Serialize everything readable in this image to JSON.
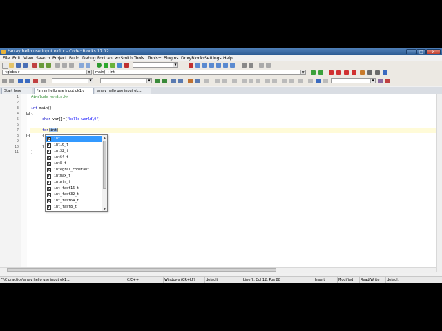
{
  "window": {
    "title": "*array hello use input ok1.c - Code::Blocks 17.12",
    "min": "_",
    "max": "□",
    "close": "x"
  },
  "menu": [
    "File",
    "Edit",
    "View",
    "Search",
    "Project",
    "Build",
    "Debug",
    "Fortran",
    "wxSmith",
    "Tools",
    "Tools+",
    "Plugins",
    "DoxyBlocks",
    "Settings",
    "Help"
  ],
  "toolbar": {
    "scope_select": "<global>",
    "function_select": "main() : int"
  },
  "tabs": [
    {
      "label": "Start here"
    },
    {
      "label": "*array hello use input ok1.c",
      "active": true
    },
    {
      "label": "array hello use input ok.c"
    }
  ],
  "editor": {
    "line_numbers": [
      "1",
      "2",
      "3",
      "4",
      "5",
      "6",
      "7",
      "8",
      "9",
      "10",
      "11"
    ],
    "line1": "#include <stdio.h>",
    "line3_kw": "int",
    "line3_rest": " main()",
    "line4": "{",
    "line5_kw": "char",
    "line5_mid": " var[]={",
    "line5_str": "\"hello world\\0\"",
    "line5_end": "}",
    "line7_kw": "for",
    "line7_paren": "(",
    "line7_typed": "int",
    "line7_close": ")",
    "line8": "{",
    "line10": "}",
    "line11": "}"
  },
  "autocomplete": {
    "icon": "C",
    "items": [
      "int",
      "int16_t",
      "int32_t",
      "int64_t",
      "int8_t",
      "integral_constant",
      "intmax_t",
      "intptr_t",
      "int_fast16_t",
      "int_fast32_t",
      "int_fast64_t",
      "int_fast8_t"
    ],
    "selected_index": 0,
    "scroll_up": "▲",
    "scroll_down": "▼"
  },
  "statusbar": {
    "path": "F:\\C practice\\array hello use input ok1.c",
    "language": "C/C++",
    "line_ending": "Windows (CR+LF)",
    "encoding": "default",
    "position": "Line 7, Col 12, Pos 88",
    "mode": "Insert",
    "modified": "Modified",
    "access": "Read/Write",
    "profile": "default"
  },
  "colors": {
    "titlebar": "#2b5b93",
    "preprocessor": "#2a8a2a",
    "keyword": "#0000c8",
    "selection": "#3399ff"
  }
}
